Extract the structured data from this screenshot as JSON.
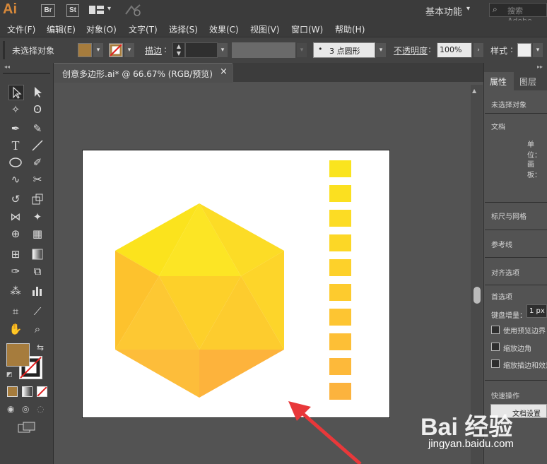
{
  "app": {
    "logo": "Ai",
    "bridge": "Br",
    "stock": "St",
    "workspace": "基本功能",
    "search_placeholder": "搜索 Adobe"
  },
  "menu": [
    "文件(F)",
    "编辑(E)",
    "对象(O)",
    "文字(T)",
    "选择(S)",
    "效果(C)",
    "视图(V)",
    "窗口(W)",
    "帮助(H)"
  ],
  "control": {
    "selection_status": "未选择对象",
    "stroke_label": "描边",
    "brush_value": "3 点圆形",
    "opacity_label": "不透明度",
    "opacity_value": "100%",
    "style_label": "样式"
  },
  "document": {
    "tab_title": "创意多边形.ai* @ 66.67% (RGB/预览)",
    "close": "×"
  },
  "colors": {
    "fill": "#a67c3d",
    "swatches": [
      "#fae41e",
      "#fbe020",
      "#fcdc24",
      "#fcd726",
      "#fdd12a",
      "#fdcb2e",
      "#fdc532",
      "#fdbf36",
      "#fdb93a",
      "#fcb33e"
    ],
    "arrow": "#e8383a",
    "hex_top": "#fbe71f",
    "hex_mid": "#fdd128",
    "hex_bot": "#fdb33a"
  },
  "right_panel": {
    "tabs": [
      "属性",
      "图层"
    ],
    "no_selection": "未选择对象",
    "document": "文档",
    "units": "单位：",
    "artboard": "画板：",
    "rulers_grid": "标尺与网格",
    "guides": "参考线",
    "align": "对齐选项",
    "preferences": "首选项",
    "keyboard_increment": "键盘增量：",
    "increment_value": "1 px",
    "opt_preview_bounds": "使用预览边界",
    "opt_scale_corners": "缩放边角",
    "opt_scale_strokes": "缩放描边和效果",
    "quick_actions": "快速操作",
    "doc_setup_button": "文档设置"
  },
  "watermark": {
    "brand": "Bai 经验",
    "url": "jingyan.baidu.com"
  }
}
